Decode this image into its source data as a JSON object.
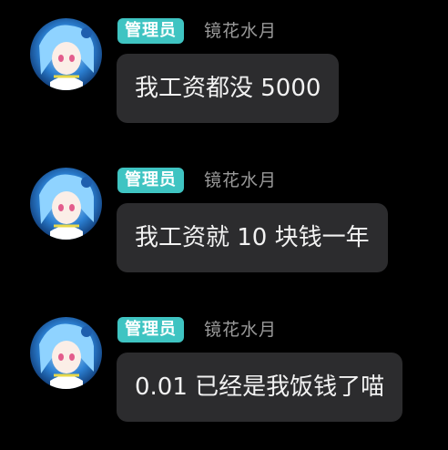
{
  "messages": [
    {
      "role_badge": "管理员",
      "nickname": "镜花水月",
      "text": "我工资都没 5000"
    },
    {
      "role_badge": "管理员",
      "nickname": "镜花水月",
      "text": "我工资就 10 块钱一年"
    },
    {
      "role_badge": "管理员",
      "nickname": "镜花水月",
      "text": "0.01 已经是我饭钱了喵"
    }
  ],
  "colors": {
    "background": "#000000",
    "badge": "#3fc4c2",
    "bubble": "#2c2c2e",
    "nickname": "#9a9a9a",
    "text": "#f2f2f2"
  }
}
